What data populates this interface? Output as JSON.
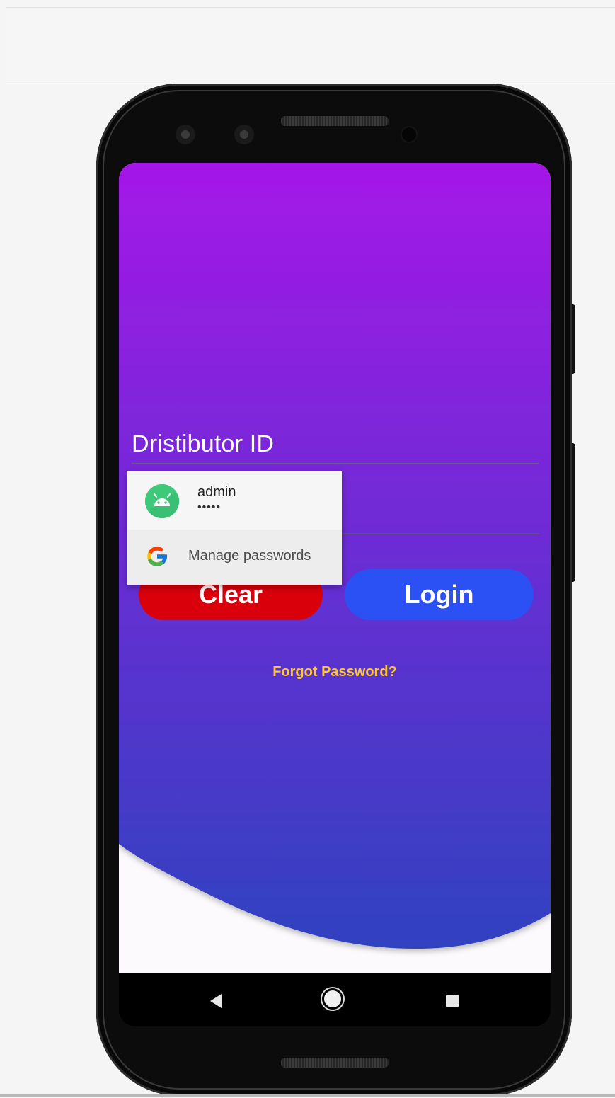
{
  "form": {
    "distributor_label": "Dristibutor ID"
  },
  "buttons": {
    "clear_label": "Clear",
    "login_label": "Login"
  },
  "links": {
    "forgot_password": "Forgot Password?"
  },
  "autofill": {
    "username": "admin",
    "password_mask": "•••••",
    "manage_label": "Manage passwords"
  },
  "colors": {
    "gradient_top": "#a518e8",
    "gradient_bottom": "#2f42c0",
    "clear_button": "#d9000c",
    "login_button": "#2b51f5",
    "forgot_link": "#ffc62e"
  },
  "icons": {
    "autofill_avatar": "android-icon",
    "manage_icon": "google-g-icon",
    "nav_back": "back-triangle-icon",
    "nav_home": "home-circle-icon",
    "nav_recent": "recent-square-icon"
  }
}
